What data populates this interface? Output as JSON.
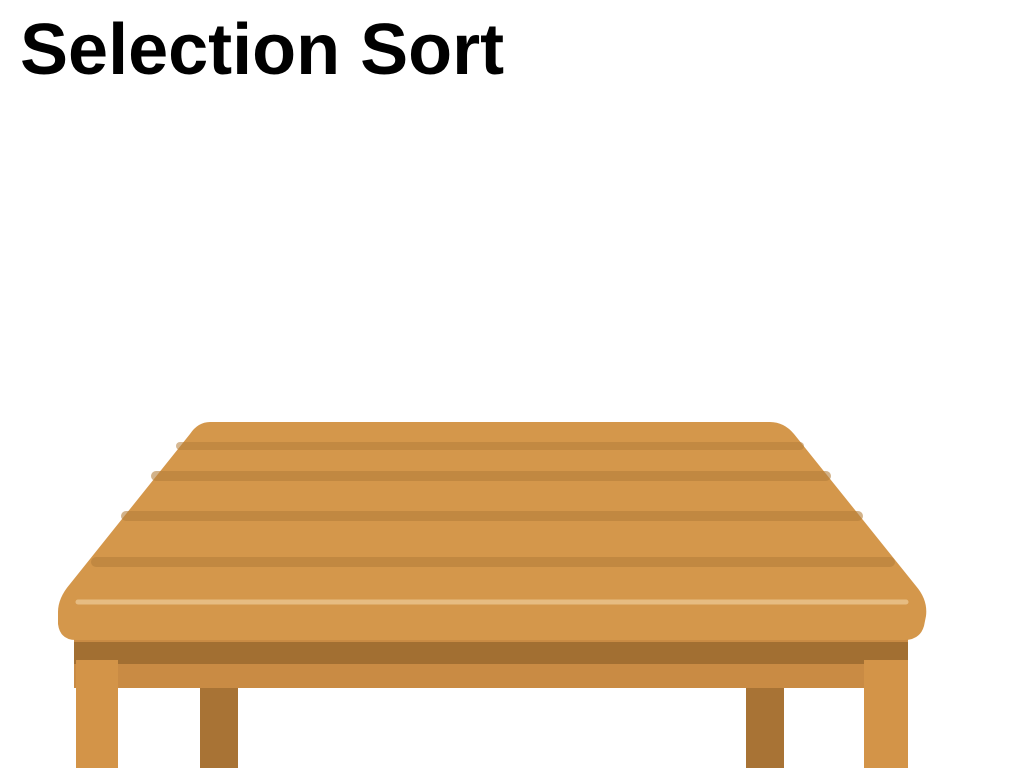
{
  "page": {
    "title": "Selection Sort"
  },
  "illustration": {
    "icon": "wooden-table-icon",
    "colors": {
      "wood_top": "#D4974B",
      "wood_stripe": "#B57F3C",
      "wood_highlight": "#E6BC82",
      "wood_apron": "#C98B44",
      "wood_dark": "#A26F32",
      "leg_front": "#D39448",
      "leg_back": "#A87335"
    }
  }
}
